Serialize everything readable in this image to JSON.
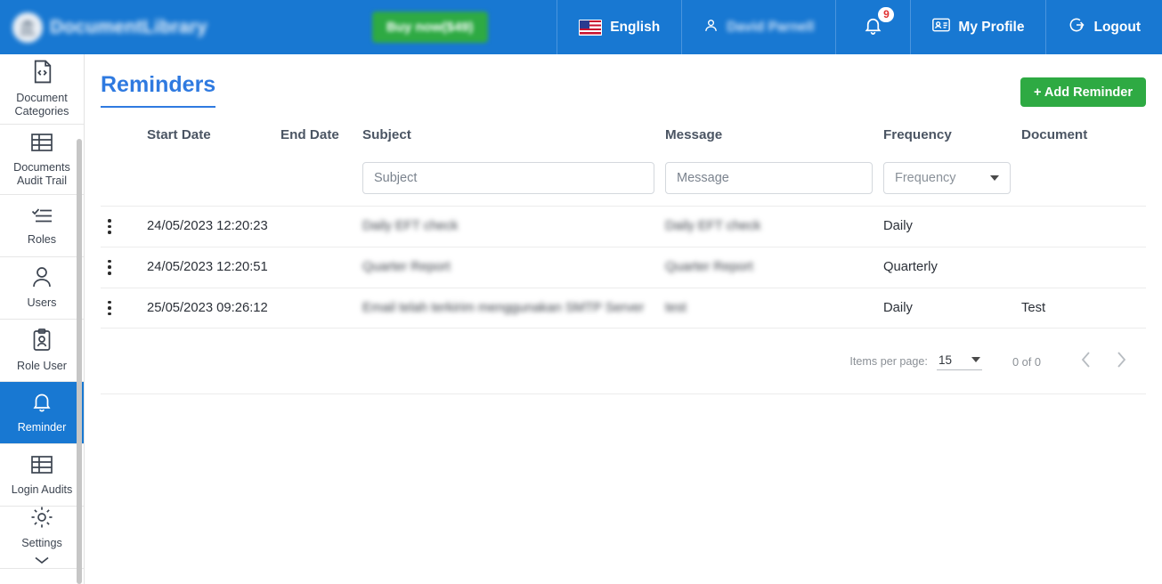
{
  "header": {
    "brand_name": "DocumentLibrary",
    "logo_icon": "library-building-icon",
    "buy_label": "Buy now($49)",
    "language": "English",
    "language_icon": "us-flag-icon",
    "user_name": "David Parnell",
    "user_icon": "person-icon",
    "notification_icon": "bell-icon",
    "notification_count": "9",
    "profile_label": "My Profile",
    "profile_icon": "id-card-icon",
    "logout_label": "Logout",
    "logout_icon": "logout-icon"
  },
  "sidebar": {
    "items": [
      {
        "label": "Document Categories",
        "icon": "code-file-icon",
        "active": false
      },
      {
        "label": "Documents Audit Trail",
        "icon": "table-icon",
        "active": false
      },
      {
        "label": "Roles",
        "icon": "checklist-icon",
        "active": false
      },
      {
        "label": "Users",
        "icon": "person-icon",
        "active": false
      },
      {
        "label": "Role User",
        "icon": "clipboard-person-icon",
        "active": false
      },
      {
        "label": "Reminder",
        "icon": "bell-icon",
        "active": true
      },
      {
        "label": "Login Audits",
        "icon": "table-icon",
        "active": false
      },
      {
        "label": "Settings",
        "icon": "gear-icon",
        "active": false
      }
    ]
  },
  "page": {
    "title": "Reminders",
    "add_button": "+ Add Reminder"
  },
  "table": {
    "columns": [
      "",
      "Start Date",
      "End Date",
      "Subject",
      "Message",
      "Frequency",
      "Document"
    ],
    "filters": {
      "subject_placeholder": "Subject",
      "message_placeholder": "Message",
      "frequency_placeholder": "Frequency"
    },
    "rows": [
      {
        "menu_icon": "kebab-menu-icon",
        "start_date": "24/05/2023 12:20:23",
        "end_date": "",
        "subject": "Daily EFT check",
        "message": "Daily EFT check",
        "frequency": "Daily",
        "document": ""
      },
      {
        "menu_icon": "kebab-menu-icon",
        "start_date": "24/05/2023 12:20:51",
        "end_date": "",
        "subject": "Quarter Report",
        "message": "Quarter Report",
        "frequency": "Quarterly",
        "document": ""
      },
      {
        "menu_icon": "kebab-menu-icon",
        "start_date": "25/05/2023 09:26:12",
        "end_date": "",
        "subject": "Email telah terkirim menggunakan SMTP Server",
        "message": "test",
        "frequency": "Daily",
        "document": "Test"
      }
    ]
  },
  "paginator": {
    "items_per_page_label": "Items per page:",
    "items_per_page_value": "15",
    "range_label": "0 of 0",
    "prev_icon": "chevron-left-icon",
    "next_icon": "chevron-right-icon"
  },
  "colors": {
    "header_blue": "#1878d2",
    "accent_blue": "#2f7ae0",
    "green": "#2eaa43",
    "badge_red": "#e03131"
  }
}
